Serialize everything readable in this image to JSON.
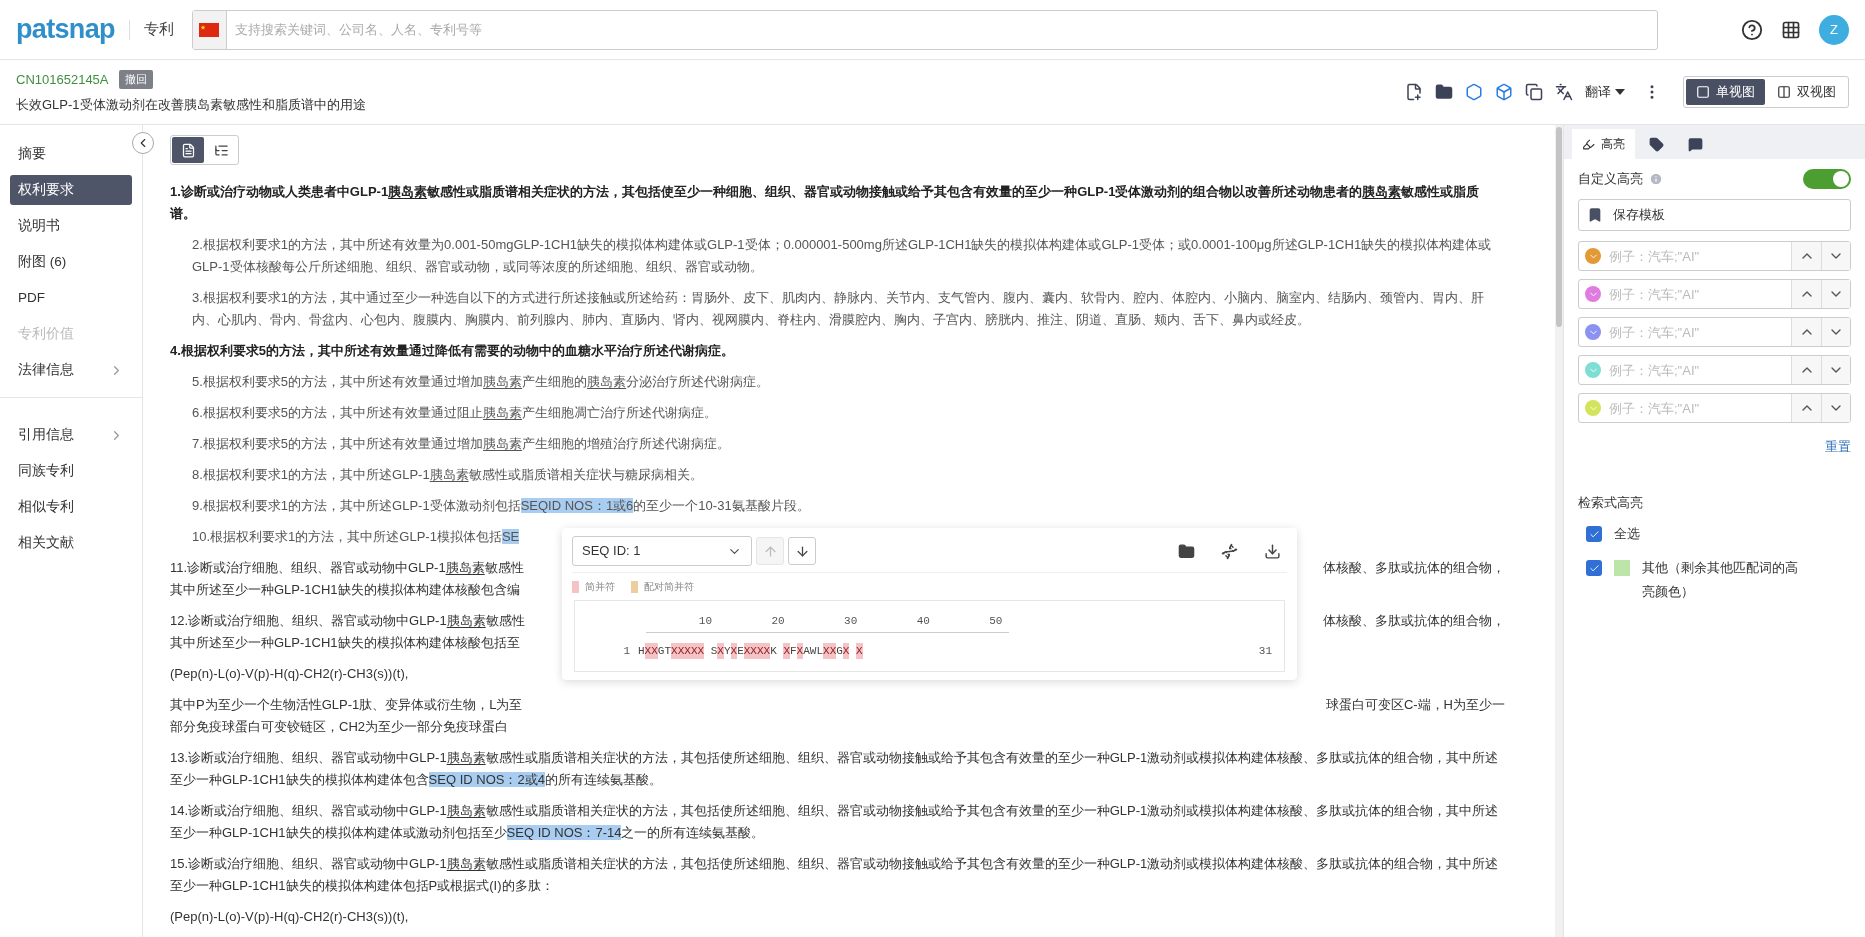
{
  "header": {
    "logo": "patsnap",
    "section": "专利",
    "search_placeholder": "支持搜索关键词、公司名、人名、专利号等",
    "avatar": "Z"
  },
  "patent": {
    "number": "CN101652145A",
    "status": "撤回",
    "title": "长效GLP-1受体激动剂在改善胰岛素敏感性和脂质谱中的用途",
    "translate": "翻译",
    "views": [
      {
        "label": "单视图",
        "selected": true
      },
      {
        "label": "双视图",
        "selected": false
      }
    ]
  },
  "sidebar": {
    "groups": [
      [
        {
          "label": "摘要",
          "selected": false,
          "disabled": false,
          "expandable": false
        },
        {
          "label": "权利要求",
          "selected": true,
          "disabled": false,
          "expandable": false
        },
        {
          "label": "说明书",
          "selected": false,
          "disabled": false,
          "expandable": false
        },
        {
          "label": "附图 (6)",
          "selected": false,
          "disabled": false,
          "expandable": false
        },
        {
          "label": "PDF",
          "selected": false,
          "disabled": false,
          "expandable": false
        },
        {
          "label": "专利价值",
          "selected": false,
          "disabled": true,
          "expandable": false
        },
        {
          "label": "法律信息",
          "selected": false,
          "disabled": false,
          "expandable": true
        }
      ],
      [
        {
          "label": "引用信息",
          "selected": false,
          "disabled": false,
          "expandable": true
        },
        {
          "label": "同族专利",
          "selected": false,
          "disabled": false,
          "expandable": false
        },
        {
          "label": "相似专利",
          "selected": false,
          "disabled": false,
          "expandable": false
        },
        {
          "label": "相关文献",
          "selected": false,
          "disabled": false,
          "expandable": false
        }
      ]
    ]
  },
  "view_toggle": [
    {
      "selected": true
    },
    {
      "selected": false
    }
  ],
  "claims": [
    {
      "kind": "text",
      "dependent": false,
      "emphasized": true,
      "segments": [
        {
          "kind": "plain",
          "text": "1.诊断或治疗动物或人类患者中GLP-1"
        },
        {
          "kind": "term",
          "text": "胰岛素"
        },
        {
          "kind": "plain",
          "text": "敏感性或脂质谱相关症状的方法，其包括使至少一种细胞、组织、器官或动物接触或给予其包含有效量的至少一种GLP-1受体激动剂的组合物以改善所述动物患者的"
        },
        {
          "kind": "term",
          "text": "胰岛素"
        },
        {
          "kind": "plain",
          "text": "敏感性或脂质谱。"
        }
      ]
    },
    {
      "kind": "text",
      "dependent": true,
      "emphasized": false,
      "segments": [
        {
          "kind": "plain",
          "text": "2.根据权利要求1的方法，其中所述有效量为0.001-50mgGLP-1CH1缺失的模拟体构建体或GLP-1受体；0.000001-500mg所述GLP-1CH1缺失的模拟体构建体或GLP-1受体；或0.0001-100μg所述GLP-1CH1缺失的模拟体构建体或GLP-1受体核酸每公斤所述细胞、组织、器官或动物，或同等浓度的所述细胞、组织、器官或动物。"
        }
      ]
    },
    {
      "kind": "text",
      "dependent": true,
      "emphasized": false,
      "segments": [
        {
          "kind": "plain",
          "text": "3.根据权利要求1的方法，其中通过至少一种选自以下的方式进行所述接触或所述给药：胃肠外、皮下、肌肉内、静脉内、关节内、支气管内、腹内、囊内、软骨内、腔内、体腔内、小脑内、脑室内、结肠内、颈管内、胃内、肝内、心肌内、骨内、骨盆内、心包内、腹膜内、胸膜内、前列腺内、肺内、直肠内、肾内、视网膜内、脊柱内、滑膜腔内、胸内、子宫内、膀胱内、推注、阴道、直肠、颊内、舌下、鼻内或经皮。"
        }
      ]
    },
    {
      "kind": "text",
      "dependent": false,
      "emphasized": true,
      "segments": [
        {
          "kind": "plain",
          "text": "4.根据权利要求5的方法，其中所述有效量通过降低有需要的动物中的血糖水平治疗所述代谢病症。"
        }
      ]
    },
    {
      "kind": "text",
      "dependent": true,
      "emphasized": false,
      "segments": [
        {
          "kind": "plain",
          "text": "5.根据权利要求5的方法，其中所述有效量通过增加"
        },
        {
          "kind": "term",
          "text": "胰岛素"
        },
        {
          "kind": "plain",
          "text": "产生细胞的"
        },
        {
          "kind": "term",
          "text": "胰岛素"
        },
        {
          "kind": "plain",
          "text": "分泌治疗所述代谢病症。"
        }
      ]
    },
    {
      "kind": "text",
      "dependent": true,
      "emphasized": false,
      "segments": [
        {
          "kind": "plain",
          "text": "6.根据权利要求5的方法，其中所述有效量通过阻止"
        },
        {
          "kind": "term",
          "text": "胰岛素"
        },
        {
          "kind": "plain",
          "text": "产生细胞凋亡治疗所述代谢病症。"
        }
      ]
    },
    {
      "kind": "text",
      "dependent": true,
      "emphasized": false,
      "segments": [
        {
          "kind": "plain",
          "text": "7.根据权利要求5的方法，其中所述有效量通过增加"
        },
        {
          "kind": "term",
          "text": "胰岛素"
        },
        {
          "kind": "plain",
          "text": "产生细胞的增殖治疗所述代谢病症。"
        }
      ]
    },
    {
      "kind": "text",
      "dependent": true,
      "emphasized": false,
      "segments": [
        {
          "kind": "plain",
          "text": "8.根据权利要求1的方法，其中所述GLP-1"
        },
        {
          "kind": "term",
          "text": "胰岛素"
        },
        {
          "kind": "plain",
          "text": "敏感性或脂质谱相关症状与糖尿病相关。"
        }
      ]
    },
    {
      "kind": "text",
      "dependent": true,
      "emphasized": false,
      "segments": [
        {
          "kind": "plain",
          "text": "9.根据权利要求1的方法，其中所述GLP-1受体激动剂包括"
        },
        {
          "kind": "highlight",
          "text": "SEQID NOS：1或6"
        },
        {
          "kind": "plain",
          "text": "的至少一个10-31氨基酸片段。"
        }
      ]
    },
    {
      "kind": "text",
      "dependent": true,
      "emphasized": false,
      "segments": [
        {
          "kind": "plain",
          "text": "10.根据权利要求1的方法，其中所述GLP-1模拟体包括"
        },
        {
          "kind": "highlight",
          "text": "SE"
        }
      ]
    },
    {
      "kind": "covered",
      "dependent": false,
      "emphasized": false,
      "lines": [
        {
          "left": [
            {
              "kind": "plain",
              "text": "11.诊断或治疗细胞、组织、器官或动物中GLP-1"
            },
            {
              "kind": "term",
              "text": "胰岛素"
            },
            {
              "kind": "plain",
              "text": "敏感性"
            }
          ],
          "right": [
            {
              "kind": "plain",
              "text": "体核酸、多肽或抗体的组合物，"
            }
          ]
        },
        {
          "left": [
            {
              "kind": "plain",
              "text": "其中所述至少一种GLP-1CH1缺失的模拟体构建体核酸包含编"
            }
          ]
        }
      ]
    },
    {
      "kind": "covered",
      "dependent": false,
      "emphasized": false,
      "lines": [
        {
          "left": [
            {
              "kind": "plain",
              "text": "12.诊断或治疗细胞、组织、器官或动物中GLP-1"
            },
            {
              "kind": "term",
              "text": "胰岛素"
            },
            {
              "kind": "plain",
              "text": "敏感性"
            }
          ],
          "right": [
            {
              "kind": "plain",
              "text": "体核酸、多肽或抗体的组合物，"
            }
          ]
        },
        {
          "left": [
            {
              "kind": "plain",
              "text": "其中所述至少一种GLP-1CH1缺失的模拟体构建体核酸包括至"
            }
          ]
        }
      ]
    },
    {
      "kind": "text",
      "dependent": false,
      "emphasized": false,
      "segments": [
        {
          "kind": "plain",
          "text": "(Pep(n)-L(o)-V(p)-H(q)-CH2(r)-CH3(s))(t),"
        }
      ]
    },
    {
      "kind": "covered",
      "dependent": false,
      "emphasized": false,
      "lines": [
        {
          "left": [
            {
              "kind": "plain",
              "text": "其中P为至少一个生物活性GLP-1肽、变异体或衍生物，L为至"
            }
          ],
          "right": [
            {
              "kind": "plain",
              "text": "球蛋白可变区C-端，H为至少一"
            }
          ]
        },
        {
          "left": [
            {
              "kind": "plain",
              "text": "部分免疫球蛋白可变铰链区，CH2为至少一部分免疫球蛋白"
            }
          ]
        }
      ]
    },
    {
      "kind": "text",
      "dependent": false,
      "emphasized": false,
      "segments": [
        {
          "kind": "plain",
          "text": "13.诊断或治疗细胞、组织、器官或动物中GLP-1"
        },
        {
          "kind": "term",
          "text": "胰岛素"
        },
        {
          "kind": "plain",
          "text": "敏感性或脂质谱相关症状的方法，其包括使所述细胞、组织、器官或动物接触或给予其包含有效量的至少一种GLP-1激动剂或模拟体构建体核酸、多肽或抗体的组合物，其中所述至少一种GLP-1CH1缺失的模拟体构建体包含"
        },
        {
          "kind": "highlight",
          "text": "SEQ ID NOS：2或4"
        },
        {
          "kind": "plain",
          "text": "的所有连续氨基酸。"
        }
      ]
    },
    {
      "kind": "text",
      "dependent": false,
      "emphasized": false,
      "segments": [
        {
          "kind": "plain",
          "text": "14.诊断或治疗细胞、组织、器官或动物中GLP-1"
        },
        {
          "kind": "term",
          "text": "胰岛素"
        },
        {
          "kind": "plain",
          "text": "敏感性或脂质谱相关症状的方法，其包括使所述细胞、组织、器官或动物接触或给予其包含有效量的至少一种GLP-1激动剂或模拟体构建体核酸、多肽或抗体的组合物，其中所述至少一种GLP-1CH1缺失的模拟体构建体或激动剂包括至少"
        },
        {
          "kind": "highlight",
          "text": "SEQ ID NOS：7-14"
        },
        {
          "kind": "plain",
          "text": "之一的所有连续氨基酸。"
        }
      ]
    },
    {
      "kind": "text",
      "dependent": false,
      "emphasized": false,
      "segments": [
        {
          "kind": "plain",
          "text": "15.诊断或治疗细胞、组织、器官或动物中GLP-1"
        },
        {
          "kind": "term",
          "text": "胰岛素"
        },
        {
          "kind": "plain",
          "text": "敏感性或脂质谱相关症状的方法，其包括使所述细胞、组织、器官或动物接触或给予其包含有效量的至少一种GLP-1激动剂或模拟体构建体核酸、多肽或抗体的组合物，其中所述至少一种GLP-1CH1缺失的模拟体构建体包括P或根据式(I)的多肽："
        }
      ]
    },
    {
      "kind": "text",
      "dependent": false,
      "emphasized": false,
      "segments": [
        {
          "kind": "plain",
          "text": "(Pep(n)-L(o)-V(p)-H(q)-CH2(r)-CH3(s))(t),"
        }
      ]
    }
  ],
  "sequence_viewer": {
    "select": "SEQ ID: 1",
    "up_disabled": true,
    "down_disabled": false,
    "legend": [
      {
        "label": "简并符",
        "color": "#f5c2c6"
      },
      {
        "label": "配对简并符",
        "color": "#edcf9f"
      }
    ],
    "ruler": [
      "10",
      "20",
      "30",
      "40",
      "50"
    ],
    "row_start": "1",
    "row_end": "31",
    "blocks": [
      {
        "letters": "HXXGTXXXXX",
        "degenerate": [
          false,
          true,
          true,
          false,
          false,
          true,
          true,
          true,
          true,
          true
        ]
      },
      {
        "letters": "SXYXEXXXXK",
        "degenerate": [
          false,
          true,
          false,
          true,
          false,
          true,
          true,
          true,
          true,
          false
        ]
      },
      {
        "letters": "XFXAWLXXGX",
        "degenerate": [
          true,
          false,
          true,
          false,
          false,
          false,
          true,
          true,
          false,
          true
        ]
      },
      {
        "letters": "X",
        "degenerate": [
          true
        ]
      }
    ]
  },
  "right_panel": {
    "tabs": [
      {
        "kind": "highlight",
        "label": "高亮",
        "selected": true
      },
      {
        "kind": "tag",
        "selected": false
      },
      {
        "kind": "comment",
        "selected": false
      }
    ],
    "custom_title": "自定义高亮",
    "custom_on": true,
    "save_template": "保存模板",
    "highlight_rows": [
      {
        "color": "#e39a36",
        "placeholder": "例子：汽车;\"AI\""
      },
      {
        "color": "#e07ce0",
        "placeholder": "例子：汽车;\"AI\""
      },
      {
        "color": "#8c92f0",
        "placeholder": "例子：汽车;\"AI\""
      },
      {
        "color": "#7fded3",
        "placeholder": "例子：汽车;\"AI\""
      },
      {
        "color": "#d2e35c",
        "placeholder": "例子：汽车;\"AI\""
      }
    ],
    "reset": "重置",
    "search_title": "检索式高亮",
    "options": [
      {
        "label": "全选",
        "checked": true
      },
      {
        "label": "其他（剩余其他匹配词的高亮颜色）",
        "checked": true,
        "color": "#bde5aa"
      }
    ]
  }
}
